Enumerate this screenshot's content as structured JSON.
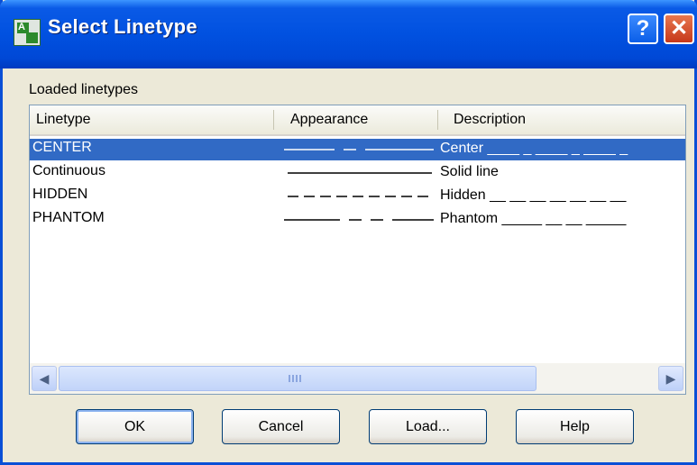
{
  "window": {
    "title": "Select Linetype"
  },
  "icons": {
    "app": "autocad-dialog-icon",
    "help": "help-icon",
    "close": "close-icon",
    "scroll_left": "arrow-left-icon",
    "scroll_right": "arrow-right-icon"
  },
  "section_label": "Loaded linetypes",
  "table": {
    "headers": [
      "Linetype",
      "Appearance",
      "Description"
    ],
    "rows": [
      {
        "name": "CENTER",
        "description": "Center ____ _ ____ _ ____ _",
        "pattern": "center",
        "selected": true
      },
      {
        "name": "Continuous",
        "description": "Solid line",
        "pattern": "continuous",
        "selected": false
      },
      {
        "name": "HIDDEN",
        "description": "Hidden __ __ __ __ __ __ __",
        "pattern": "hidden",
        "selected": false
      },
      {
        "name": "PHANTOM",
        "description": "Phantom _____ __ __ _____",
        "pattern": "phantom",
        "selected": false
      }
    ]
  },
  "buttons": {
    "ok": "OK",
    "cancel": "Cancel",
    "load": "Load...",
    "help": "Help"
  },
  "colors": {
    "selection": "#316ac5",
    "titlebar": "#0151e0",
    "dialog_bg": "#ece9d8"
  }
}
